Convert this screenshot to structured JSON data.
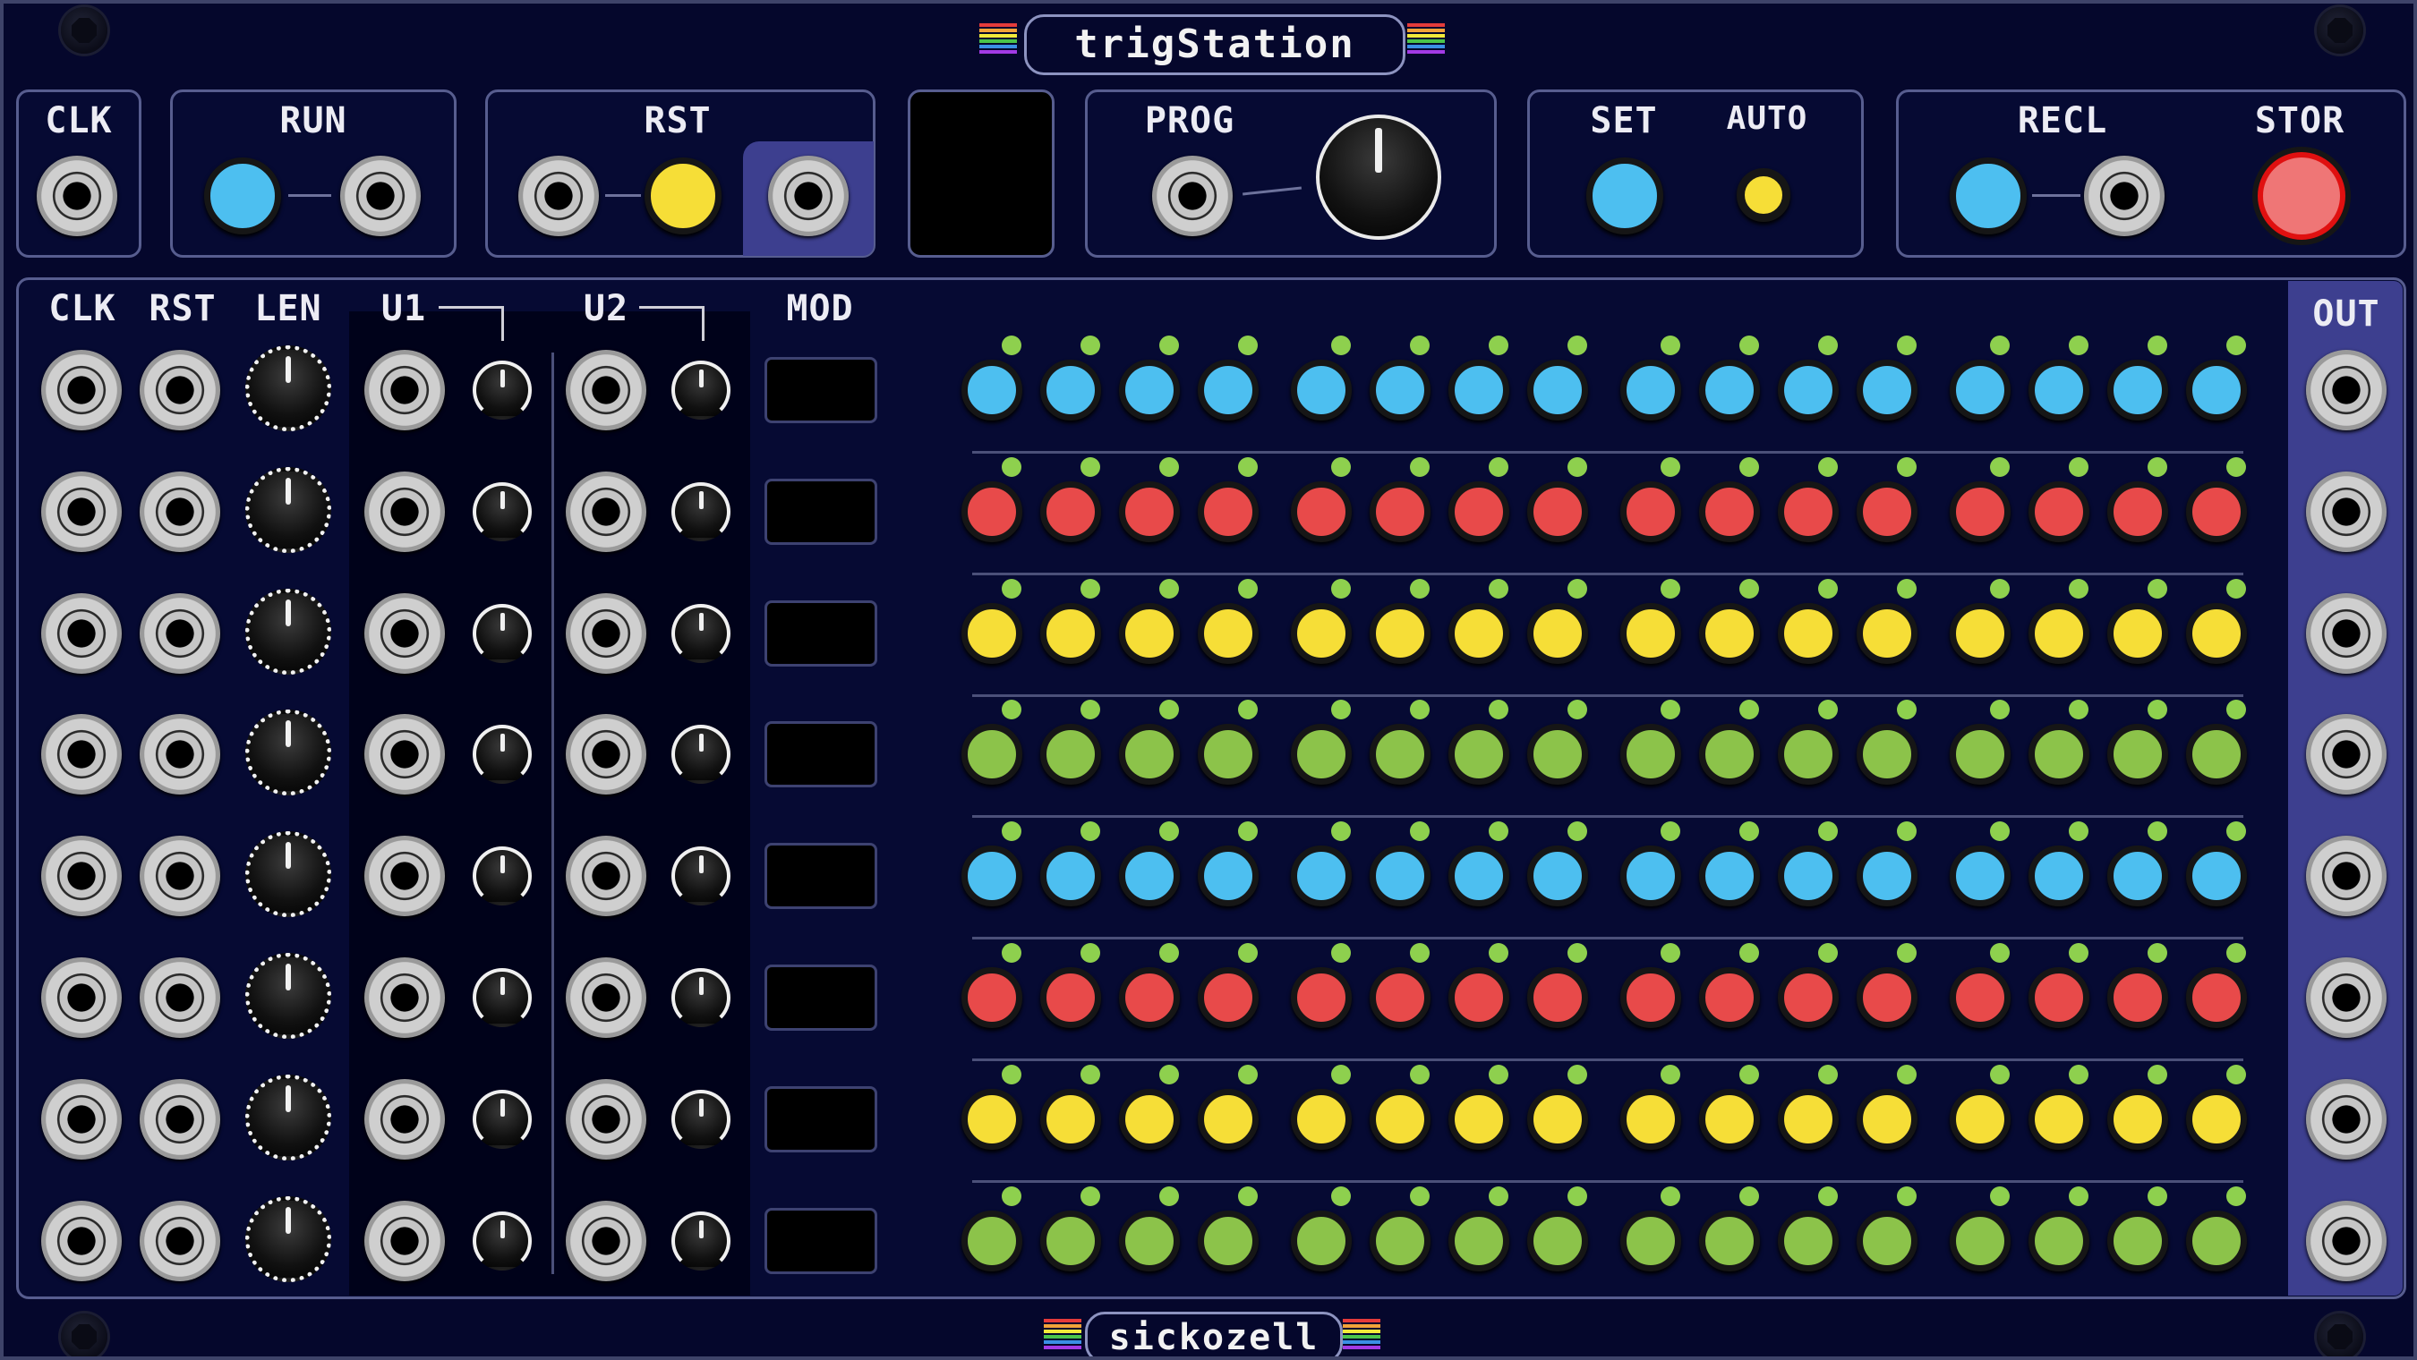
{
  "module": {
    "title": "trigStation",
    "brand": "sickozell"
  },
  "header": {
    "clk_label": "CLK",
    "run_label": "RUN",
    "rst_label": "RST",
    "prog_label": "PROG",
    "set_label": "SET",
    "auto_label": "AUTO",
    "recl_label": "RECL",
    "stor_label": "STOR"
  },
  "columns": {
    "clk": "CLK",
    "rst": "RST",
    "len": "LEN",
    "u1": "U1",
    "u2": "U2",
    "mod": "MOD",
    "out": "OUT"
  },
  "grid": {
    "rows": 8,
    "steps": 16,
    "row_colors": [
      "blue",
      "red",
      "yellow",
      "green",
      "blue",
      "red",
      "yellow",
      "green"
    ]
  },
  "colors": {
    "blue": "#4dbff0",
    "red": "#e84a4a",
    "yellow": "#f6de37",
    "green": "#8cc34a",
    "led": "#8ed04e",
    "stor": "#ef7676",
    "stor_ring": "#e01010",
    "title_stripes": [
      "#e53b3b",
      "#f2a33a",
      "#f2ea3a",
      "#4bc44b",
      "#3b8fe5",
      "#a33be5"
    ]
  }
}
